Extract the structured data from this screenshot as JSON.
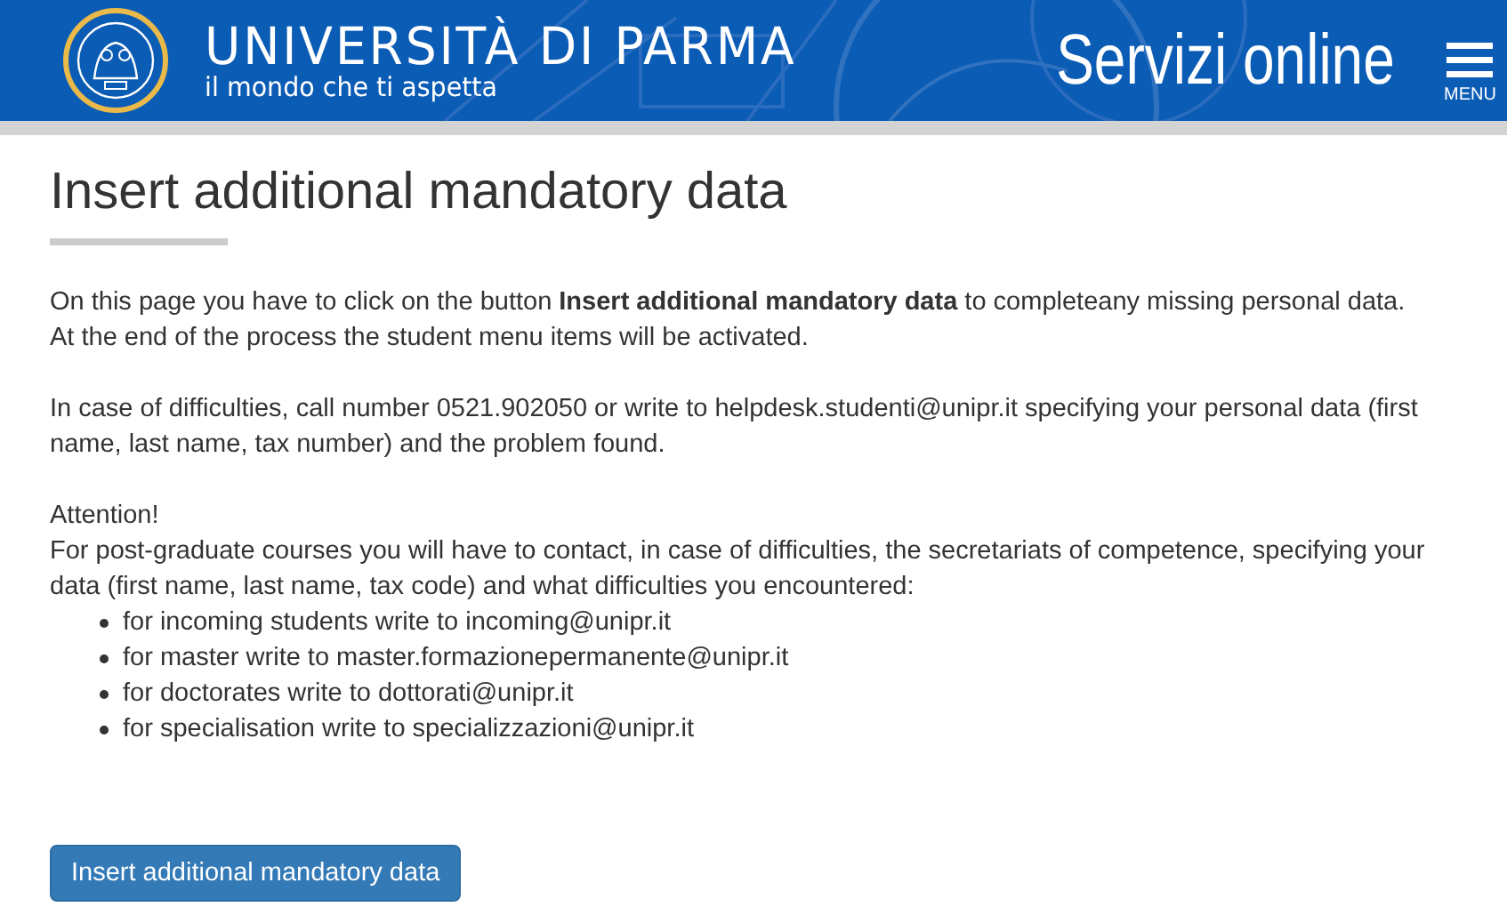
{
  "header": {
    "university": "UNIVERSITÀ DI PARMA",
    "tagline": "il mondo che ti aspetta",
    "service": "Servizi online",
    "menu_label": "MENU"
  },
  "page": {
    "title": "Insert additional mandatory data",
    "paragraphs": [
      {
        "lines": [
          "On this page you have to click on the button **Insert additional mandatory data** to completeany missing personal data.",
          "At the end of the process the student menu items will be activated."
        ]
      },
      {
        "lines": [
          "In case of difficulties, call number 0521.902050 or write to helpdesk.studenti@unipr.it specifying your personal data (first name, last name, tax number) and the problem found."
        ]
      },
      {
        "lines": [
          "Attention!",
          "For post-graduate courses you will have to contact, in case of difficulties, the secretariats of competence, specifying your data (first name, last name, tax code) and what difficulties you encountered:"
        ]
      }
    ],
    "bullets": [
      "for incoming students write to incoming@unipr.it",
      "for master write to master.formazionepermanente@unipr.it",
      "for doctorates write to dottorati@unipr.it",
      "for specialisation write to specializzazioni@unipr.it"
    ],
    "button": "Insert additional mandatory data"
  }
}
